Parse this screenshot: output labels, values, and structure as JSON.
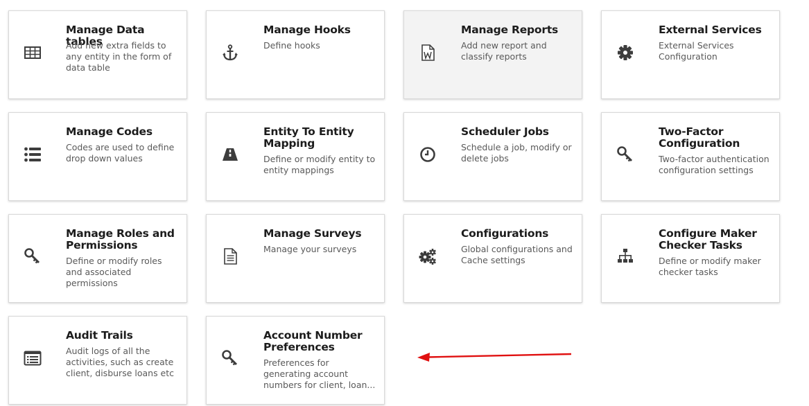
{
  "cards": [
    {
      "title": "Manage Data tables",
      "desc": "Add new extra fields to any entity in the form of data table",
      "icon": "table-icon"
    },
    {
      "title": "Manage Hooks",
      "desc": "Define hooks",
      "icon": "anchor-icon"
    },
    {
      "title": "Manage Reports",
      "desc": "Add new report and classify reports",
      "icon": "word-document-icon"
    },
    {
      "title": "External Services",
      "desc": "External Services Configuration",
      "icon": "gear-icon"
    },
    {
      "title": "Manage Codes",
      "desc": "Codes are used to define drop down values",
      "icon": "list-icon"
    },
    {
      "title": "Entity To Entity Mapping",
      "desc": "Define or modify entity to entity mappings",
      "icon": "road-icon"
    },
    {
      "title": "Scheduler Jobs",
      "desc": "Schedule a job, modify or delete jobs",
      "icon": "clock-icon"
    },
    {
      "title": "Two-Factor Configuration",
      "desc": "Two-factor authentication configuration settings",
      "icon": "key-icon"
    },
    {
      "title": "Manage Roles and Permissions",
      "desc": "Define or modify roles and associated permissions",
      "icon": "key-icon"
    },
    {
      "title": "Manage Surveys",
      "desc": "Manage your surveys",
      "icon": "document-icon"
    },
    {
      "title": "Configurations",
      "desc": "Global configurations and Cache settings",
      "icon": "gears-icon"
    },
    {
      "title": "Configure Maker Checker Tasks",
      "desc": "Define or modify maker checker tasks",
      "icon": "sitemap-icon"
    },
    {
      "title": "Audit Trails",
      "desc": "Audit logs of all the activities, such as create client, disburse loans etc",
      "icon": "list-alt-icon"
    },
    {
      "title": "Account Number Preferences",
      "desc": "Preferences for generating account numbers for client, loan...",
      "icon": "key-icon"
    }
  ],
  "colors": {
    "icon": "#3d3d3d",
    "arrow": "#e01010",
    "hover_card": "#f3f3f3"
  }
}
